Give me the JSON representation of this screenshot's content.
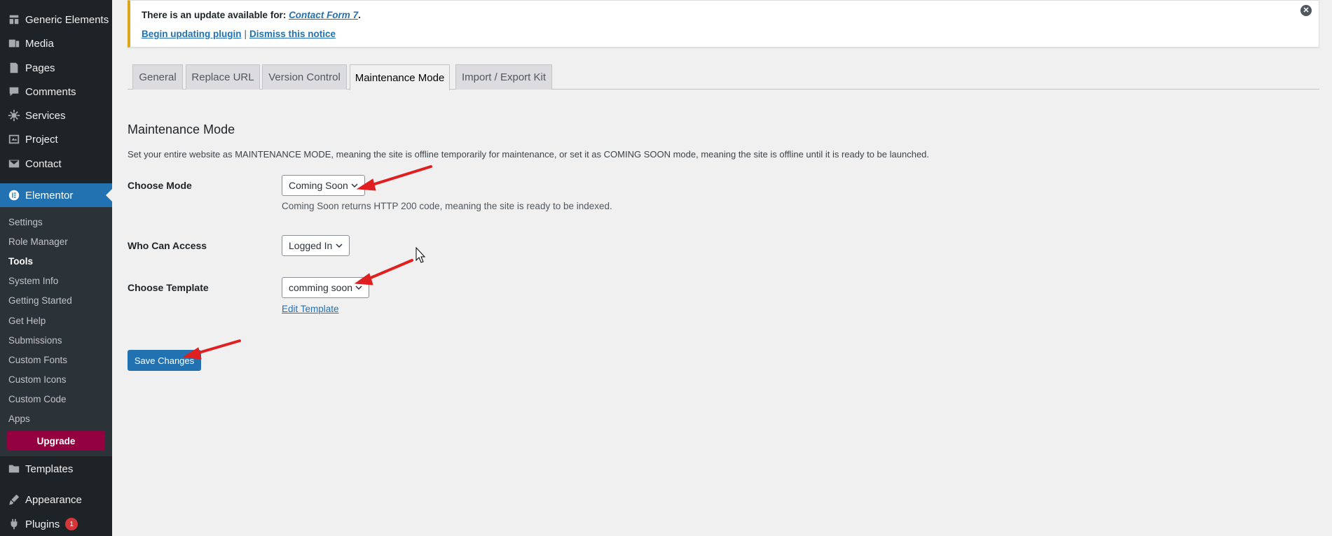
{
  "sidebar": {
    "items": [
      {
        "label": "Generic Elements",
        "icon": "generic-elements-icon"
      },
      {
        "label": "Media",
        "icon": "media-icon"
      },
      {
        "label": "Pages",
        "icon": "pages-icon"
      },
      {
        "label": "Comments",
        "icon": "comments-icon"
      },
      {
        "label": "Services",
        "icon": "gear-icon"
      },
      {
        "label": "Project",
        "icon": "project-icon"
      },
      {
        "label": "Contact",
        "icon": "envelope-icon"
      },
      {
        "label": "Elementor",
        "icon": "elementor-icon"
      },
      {
        "label": "Templates",
        "icon": "folder-icon"
      },
      {
        "label": "Appearance",
        "icon": "brush-icon"
      },
      {
        "label": "Plugins",
        "icon": "plug-icon",
        "badge": "1"
      }
    ],
    "submenu": [
      "Settings",
      "Role Manager",
      "Tools",
      "System Info",
      "Getting Started",
      "Get Help",
      "Submissions",
      "Custom Fonts",
      "Custom Icons",
      "Custom Code",
      "Apps"
    ],
    "upgrade_label": "Upgrade"
  },
  "notice": {
    "text": "There is an update available for: ",
    "plugin": "Contact Form 7",
    "period": ".",
    "update_link": "Begin updating plugin",
    "separator": "|",
    "dismiss_link": "Dismiss this notice",
    "close_glyph": "✕"
  },
  "tabs": [
    "General",
    "Replace URL",
    "Version Control",
    "Maintenance Mode",
    "Import / Export Kit"
  ],
  "main": {
    "title": "Maintenance Mode",
    "description": "Set your entire website as MAINTENANCE MODE, meaning the site is offline temporarily for maintenance, or set it as COMING SOON mode, meaning the site is offline until it is ready to be launched.",
    "choose_mode_label": "Choose Mode",
    "choose_mode_value": "Coming Soon",
    "choose_mode_help": "Coming Soon returns HTTP 200 code, meaning the site is ready to be indexed.",
    "who_can_access_label": "Who Can Access",
    "who_can_access_value": "Logged In",
    "choose_template_label": "Choose Template",
    "choose_template_value": "comming soon",
    "edit_template_link": "Edit Template",
    "save_label": "Save Changes"
  },
  "colors": {
    "sidebar_bg": "#1d2327",
    "accent": "#2271b1",
    "upgrade": "#93003f",
    "notice_border": "#dba617",
    "annotation_arrow": "#e02020"
  }
}
